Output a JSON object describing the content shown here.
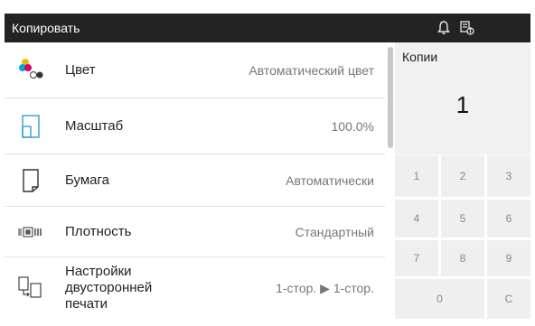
{
  "header": {
    "title": "Копировать",
    "icons": [
      "bell-icon",
      "tray-info-icon"
    ]
  },
  "settings": [
    {
      "label": "Цвет",
      "value": "Автоматический цвет",
      "icon": "color-icon"
    },
    {
      "label": "Масштаб",
      "value": "100.0%",
      "icon": "zoom-icon"
    },
    {
      "label": "Бумага",
      "value": "Автоматически",
      "icon": "paper-icon"
    },
    {
      "label": "Плотность",
      "value": "Стандартный",
      "icon": "density-icon"
    },
    {
      "label": "Настройки двусторонней печати",
      "value": "1-стор. ▶ 1-стор.",
      "icon": "duplex-icon"
    }
  ],
  "copies": {
    "label": "Копии",
    "value": "1"
  },
  "keypad": [
    "1",
    "2",
    "3",
    "4",
    "5",
    "6",
    "7",
    "8",
    "9",
    "0",
    "C"
  ],
  "colors": {
    "titlebar": "#232323",
    "panel": "#f1f1f1",
    "key": "#efefef"
  }
}
